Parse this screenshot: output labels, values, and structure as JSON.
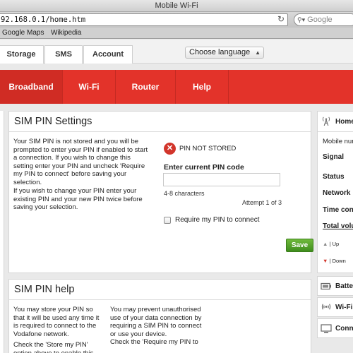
{
  "browser": {
    "window_title": "Mobile Wi-Fi",
    "url": "92.168.0.1/home.htm",
    "search_placeholder": "Google",
    "bookmarks": [
      "Google Maps",
      "Wikipedia"
    ]
  },
  "top_tabs": [
    "Storage",
    "SMS",
    "Account"
  ],
  "language": {
    "selected": "Choose language"
  },
  "main_nav": [
    "Broadband",
    "Wi-Fi",
    "Router",
    "Help"
  ],
  "sim_pin_settings": {
    "title": "SIM PIN Settings",
    "desc_1": "Your SIM PIN is not stored and you will be prompted to enter your PIN if enabled to start a connection. If you wish to change this setting enter your PIN and uncheck 'Require my PIN to connect' before saving your selection.",
    "desc_2": "If you wish to change your PIN enter your existing PIN and your new PIN twice before saving your selection.",
    "status_text": "PIN NOT STORED",
    "field_label": "Enter current PIN code",
    "field_value": "",
    "hint": "4-8 characters",
    "attempt": "Attempt 1 of 3",
    "checkbox_label": "Require my PIN to connect",
    "checkbox_checked": false,
    "save_label": "Save"
  },
  "sim_pin_help": {
    "title": "SIM PIN help",
    "col_1": "You may store your PIN so that it will be used any time it is required to connect to the Vodafone network.",
    "col_1b": "Check the 'Store my PIN' option above to enable this",
    "col_2": "You may prevent unauthorised use of your data connection by requiring a SIM PIN to connect or use your device.",
    "col_2b": "Check the 'Require my PIN to"
  },
  "sidebar": {
    "home_label": "Home",
    "rows": [
      "Mobile number",
      "Signal",
      "Status",
      "Network",
      "Time connected",
      "Total volume"
    ],
    "up_label": "| Up",
    "down_label": "| Down",
    "sections": [
      "Battery",
      "Wi-Fi",
      "Connected devices"
    ]
  },
  "colors": {
    "brand_red": "#e3332a",
    "save_green": "#4a9a24",
    "status_red": "#d2352b"
  }
}
